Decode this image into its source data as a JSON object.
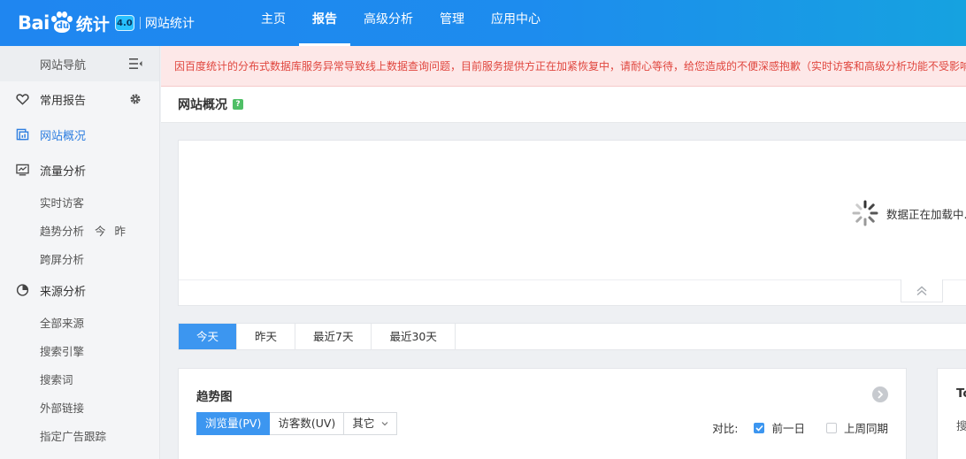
{
  "header": {
    "logo_text_left": "Bai",
    "logo_paw_text": "du",
    "logo_text_cn": "统计",
    "badge": "4.0",
    "subtitle": "网站统计",
    "nav": [
      {
        "label": "主页",
        "active": false
      },
      {
        "label": "报告",
        "active": true
      },
      {
        "label": "高级分析",
        "active": false
      },
      {
        "label": "管理",
        "active": false
      },
      {
        "label": "应用中心",
        "active": false
      }
    ]
  },
  "sidebar": {
    "title": "网站导航",
    "favorites": "常用报告",
    "overview": "网站概况",
    "traffic": {
      "label": "流量分析",
      "items": [
        "实时访客",
        "趋势分析",
        "跨屏分析"
      ],
      "quick_today": "今",
      "quick_yesterday": "昨"
    },
    "source": {
      "label": "来源分析",
      "items": [
        "全部来源",
        "搜索引擎",
        "搜索词",
        "外部链接",
        "指定广告跟踪"
      ]
    }
  },
  "alert": {
    "text": "因百度统计的分布式数据库服务异常导致线上数据查询问题，目前服务提供方正在加紧恢复中，请耐心等待，给您造成的不便深感抱歉（实时访客和高级分析功能不受影响"
  },
  "page": {
    "title": "网站概况",
    "help": "?",
    "loading_text": "数据正在加载中..."
  },
  "date_tabs": [
    {
      "label": "今天",
      "active": true
    },
    {
      "label": "昨天",
      "active": false
    },
    {
      "label": "最近7天",
      "active": false
    },
    {
      "label": "最近30天",
      "active": false
    }
  ],
  "trend": {
    "title": "趋势图",
    "metrics": [
      {
        "label": "浏览量(PV)",
        "active": true
      },
      {
        "label": "访客数(UV)",
        "active": false
      }
    ],
    "other_select": "其它",
    "compare_label": "对比:",
    "compare_prev_day": "前一日",
    "compare_prev_day_checked": true,
    "compare_last_week": "上周同期",
    "compare_last_week_checked": false
  },
  "top_card": {
    "title": "To",
    "subtitle": "搜"
  },
  "colors": {
    "accent": "#3c96f0",
    "header": "#1f86f0",
    "alert_text": "#e0463e",
    "alert_bg": "#fde8e8"
  }
}
